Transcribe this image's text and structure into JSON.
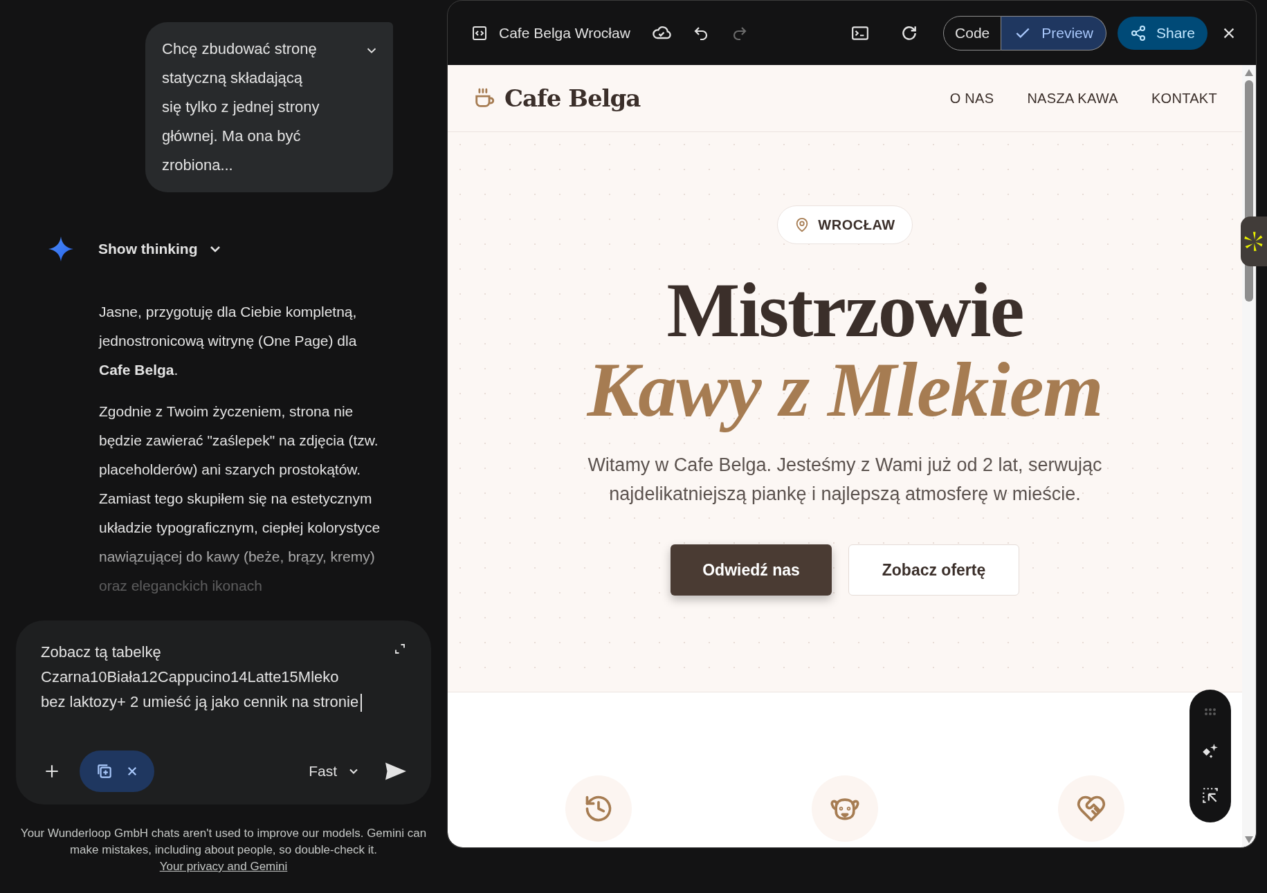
{
  "chat": {
    "user_message": {
      "text": "Chcę zbudować stronę statyczną składającą się tylko z jednej strony głównej. Ma ona być zrobiona...",
      "expanded": false
    },
    "thinking": {
      "label": "Show thinking",
      "expanded": false
    },
    "response": [
      "Jasne, przygotuję dla Ciebie kompletną, jednostronicową witrynę (One Page) dla **Cafe Belga**.",
      "Zgodnie z Twoim życzeniem, strona nie będzie zawierać \"zaślepek\" na zdjęcia (tzw. placeholderów) ani szarych prostokątów. Zamiast tego skupiłem się na estetycznym układzie typograficznym, ciepłej kolorystyce nawiązującej do kawy (beże, brązy, kremy) oraz eleganckich ikonach"
    ],
    "input": {
      "value": "Zobacz tą tabelkę Czarna10Biała12Cappucino14Latte15Mleko bez laktozy+ 2  umieść ją jako cennik na stronie"
    },
    "canvas_tool": {
      "on": true
    },
    "mode": "Fast",
    "footer": {
      "text": "Your Wunderloop GmbH chats aren't used to improve our models. Gemini can make mistakes, including about people, so double-check it.",
      "link": "Your privacy and Gemini"
    }
  },
  "canvas": {
    "title": "Cafe Belga Wrocław",
    "view_tabs": [
      {
        "label": "Code",
        "selected": false
      },
      {
        "label": "Preview",
        "selected": true
      }
    ],
    "share": "Share"
  },
  "site": {
    "brand": "Cafe Belga",
    "nav": [
      "O NAS",
      "NASZA KAWA",
      "KONTAKT"
    ],
    "location": "WROCŁAW",
    "heading": "Mistrzowie",
    "heading_accent": "Kawy z Mlekiem",
    "lead": "Witamy w Cafe Belga. Jesteśmy z Wami już od 2 lat, serwując najdelikatniejszą piankę i najlepszą atmosferę w mieście.",
    "buttons": [
      {
        "label": "Odwiedź nas",
        "kind": "primary"
      },
      {
        "label": "Zobacz ofertę",
        "kind": "secondary"
      }
    ]
  }
}
